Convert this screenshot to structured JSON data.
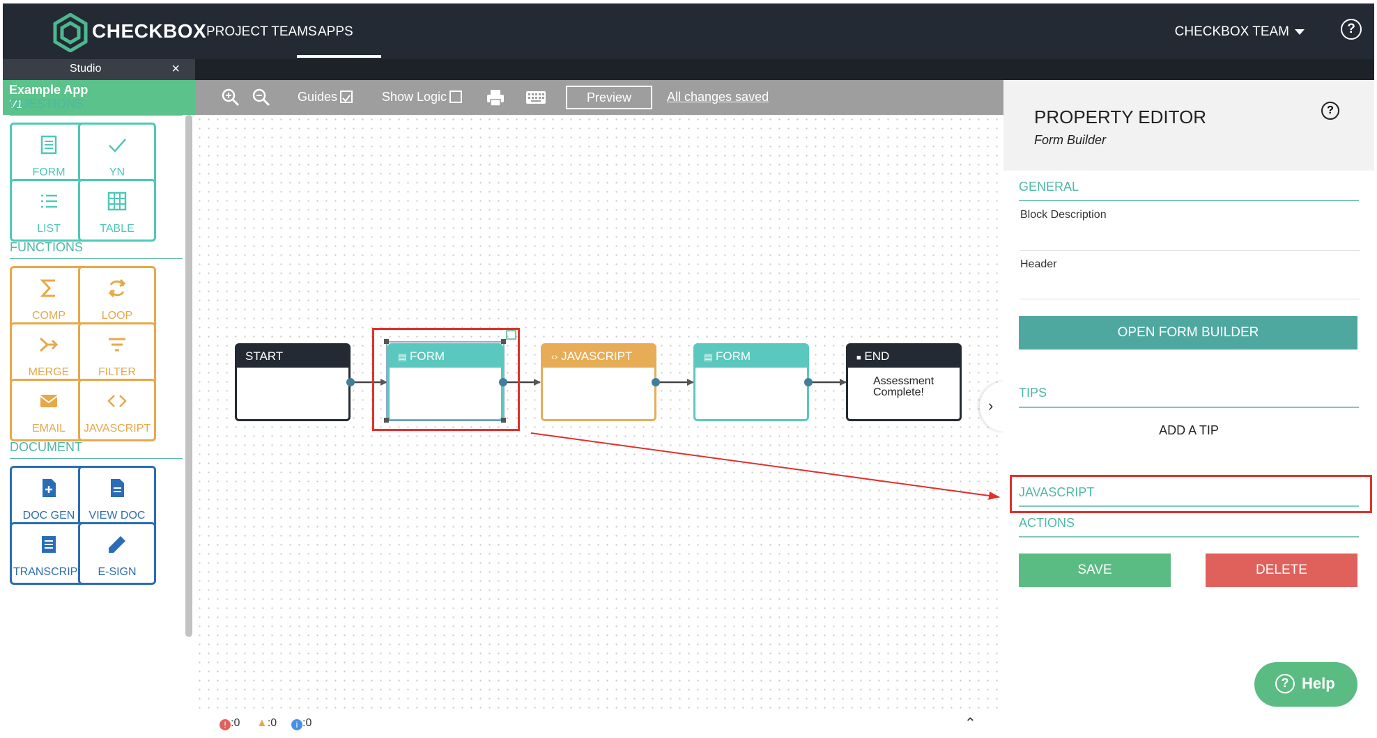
{
  "brand": {
    "name": "CHECKBOX"
  },
  "topnav": {
    "links": [
      "PROJECT TEAMS",
      "APPS"
    ],
    "team": "CHECKBOX TEAM"
  },
  "studio_tab": {
    "label": "Studio",
    "close": "×"
  },
  "app": {
    "name": "Example App",
    "version": "V1"
  },
  "sidebar": {
    "questions": {
      "title": "QUESTIONS",
      "items": [
        "FORM",
        "YN",
        "LIST",
        "TABLE"
      ]
    },
    "functions": {
      "title": "FUNCTIONS",
      "items": [
        "COMP",
        "LOOP",
        "MERGE",
        "FILTER",
        "EMAIL",
        "JAVASCRIPT"
      ]
    },
    "document": {
      "title": "DOCUMENT",
      "items": [
        "DOC GEN",
        "VIEW DOC",
        "TRANSCRIPT",
        "E-SIGN"
      ]
    }
  },
  "toolbar": {
    "guides": "Guides",
    "show_logic": "Show Logic",
    "preview": "Preview",
    "saved": "All changes saved"
  },
  "flow": {
    "nodes": [
      {
        "type": "START",
        "label": "START"
      },
      {
        "type": "FORM",
        "label": "FORM"
      },
      {
        "type": "JAVASCRIPT",
        "label": "JAVASCRIPT"
      },
      {
        "type": "FORM",
        "label": "FORM"
      },
      {
        "type": "END",
        "label": "END",
        "text_line1": "Assessment",
        "text_line2": "Complete!"
      }
    ]
  },
  "status": {
    "errors": ":0",
    "warnings": ":0",
    "info": ":0"
  },
  "property_editor": {
    "title": "PROPERTY EDITOR",
    "subtitle": "Form Builder",
    "general": "GENERAL",
    "block_description": "Block Description",
    "header": "Header",
    "open_form_builder": "OPEN FORM BUILDER",
    "tips": "TIPS",
    "add_tip": "ADD A TIP",
    "javascript": "JAVASCRIPT",
    "actions": "ACTIONS",
    "save": "SAVE",
    "delete": "DELETE"
  },
  "help_button": "Help",
  "colors": {
    "nav": "#242a33",
    "green": "#5ac28a",
    "teal": "#4ec8b7",
    "orange": "#e7a84a",
    "blue": "#2a6db6",
    "red_highlight": "#e0312b",
    "delete": "#e0605c"
  }
}
